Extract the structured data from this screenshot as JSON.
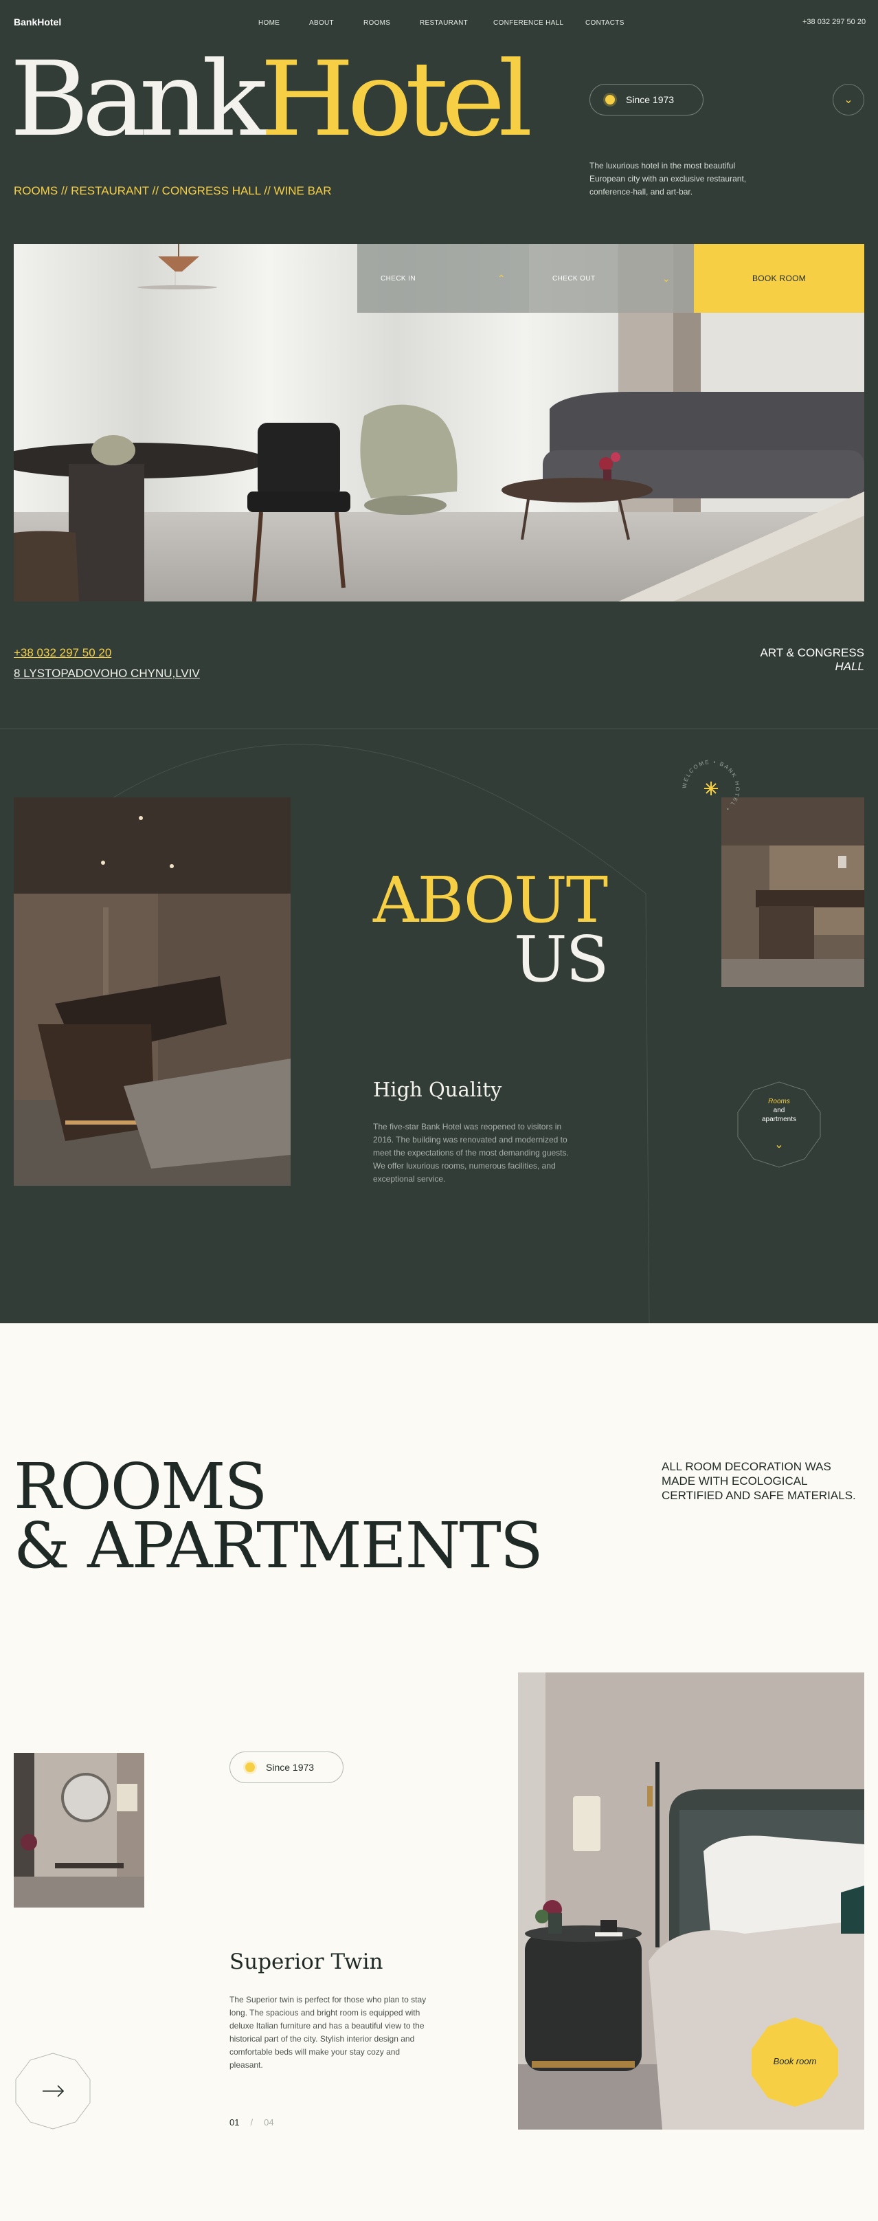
{
  "nav": {
    "logo": "BankHotel",
    "links": [
      "HOME",
      "ABOUT",
      "ROOMS",
      "RESTAURANT",
      "CONFERENCE HALL",
      "CONTACTS"
    ],
    "phone": "+38 032 297 50 20"
  },
  "hero": {
    "title_white": "Bank",
    "title_yellow": "Hotel",
    "subtitle": "ROOMS // RESTAURANT // CONGRESS HALL // WINE BAR",
    "since": "Since 1973",
    "description": "The luxurious hotel in the most beautiful European city with an exclusive restaurant, conference-hall, and art-bar."
  },
  "booking": {
    "check_in": "CHECK IN",
    "check_out": "CHECK OUT",
    "book": "BOOK ROOM"
  },
  "contacts": {
    "phone": "+38 032 297 50 20",
    "address": "8 LYSTOPADOVOHO CHYNU,LVIV",
    "hall_line1": "ART & CONGRESS",
    "hall_line2": "HALL"
  },
  "about": {
    "title1": "ABOUT",
    "title2": "US",
    "circle_text": "WELCOME • BANK HOTEL •",
    "heading": "High Quality",
    "text": "The five-star Bank Hotel was reopened to visitors in 2016. The building was renovated and modernized to meet the expectations of the most demanding guests. We offer luxurious rooms, numerous facilities, and exceptional service.",
    "badge_italic": "Rooms",
    "badge_rest": "and apartments"
  },
  "rooms": {
    "title1": "ROOMS",
    "title2": "& APARTMENTS",
    "note": "ALL ROOM DECORATION WAS MADE WITH ECOLOGICAL CERTIFIED AND SAFE MATERIALS.",
    "since": "Since 1973",
    "room_name": "Superior Twin",
    "room_text": "The Superior twin is perfect for those who plan to stay long. The spacious and bright room is equipped with deluxe Italian furniture and has a beautiful view to the historical part of the city. Stylish interior design and comfortable beds will make your stay cozy and pleasant.",
    "page_current": "01",
    "page_sep": "/",
    "page_total": "04",
    "book_label": "Book room"
  },
  "colors": {
    "dark": "#323d37",
    "accent": "#f6cf45",
    "cream": "#fcfaf4"
  }
}
